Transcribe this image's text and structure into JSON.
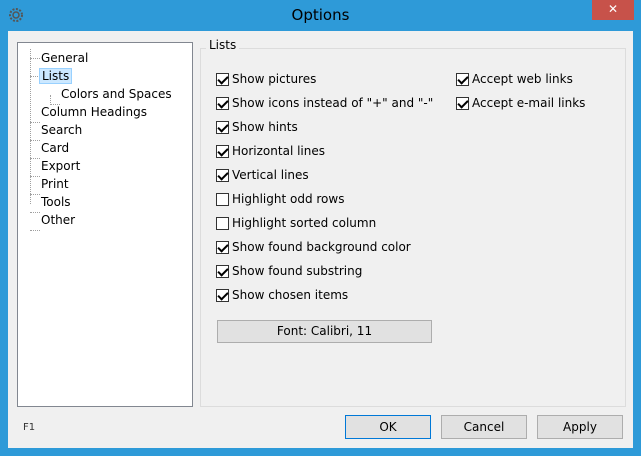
{
  "window": {
    "title": "Options",
    "close_label": "✕"
  },
  "tree": {
    "items": [
      {
        "label": "General"
      },
      {
        "label": "Lists",
        "selected": true
      },
      {
        "label": "Colors and Spaces"
      },
      {
        "label": "Column Headings"
      },
      {
        "label": "Search"
      },
      {
        "label": "Card"
      },
      {
        "label": "Export"
      },
      {
        "label": "Print"
      },
      {
        "label": "Tools"
      },
      {
        "label": "Other"
      }
    ]
  },
  "group": {
    "title": "Lists",
    "left_options": [
      {
        "label": "Show pictures",
        "checked": true
      },
      {
        "label": "Show icons instead of \"+\" and \"-\"",
        "checked": true
      },
      {
        "label": "Show hints",
        "checked": true
      },
      {
        "label": "Horizontal lines",
        "checked": true
      },
      {
        "label": "Vertical lines",
        "checked": true
      },
      {
        "label": "Highlight odd rows",
        "checked": false
      },
      {
        "label": "Highlight sorted column",
        "checked": false
      },
      {
        "label": "Show found background color",
        "checked": true
      },
      {
        "label": "Show found substring",
        "checked": true
      },
      {
        "label": "Show chosen items",
        "checked": true
      }
    ],
    "right_options": [
      {
        "label": "Accept web links",
        "checked": true
      },
      {
        "label": "Accept e-mail links",
        "checked": true
      }
    ],
    "font_button": "Font: Calibri, 11"
  },
  "footer": {
    "help_hint": "F1",
    "ok": "OK",
    "cancel": "Cancel",
    "apply": "Apply"
  }
}
